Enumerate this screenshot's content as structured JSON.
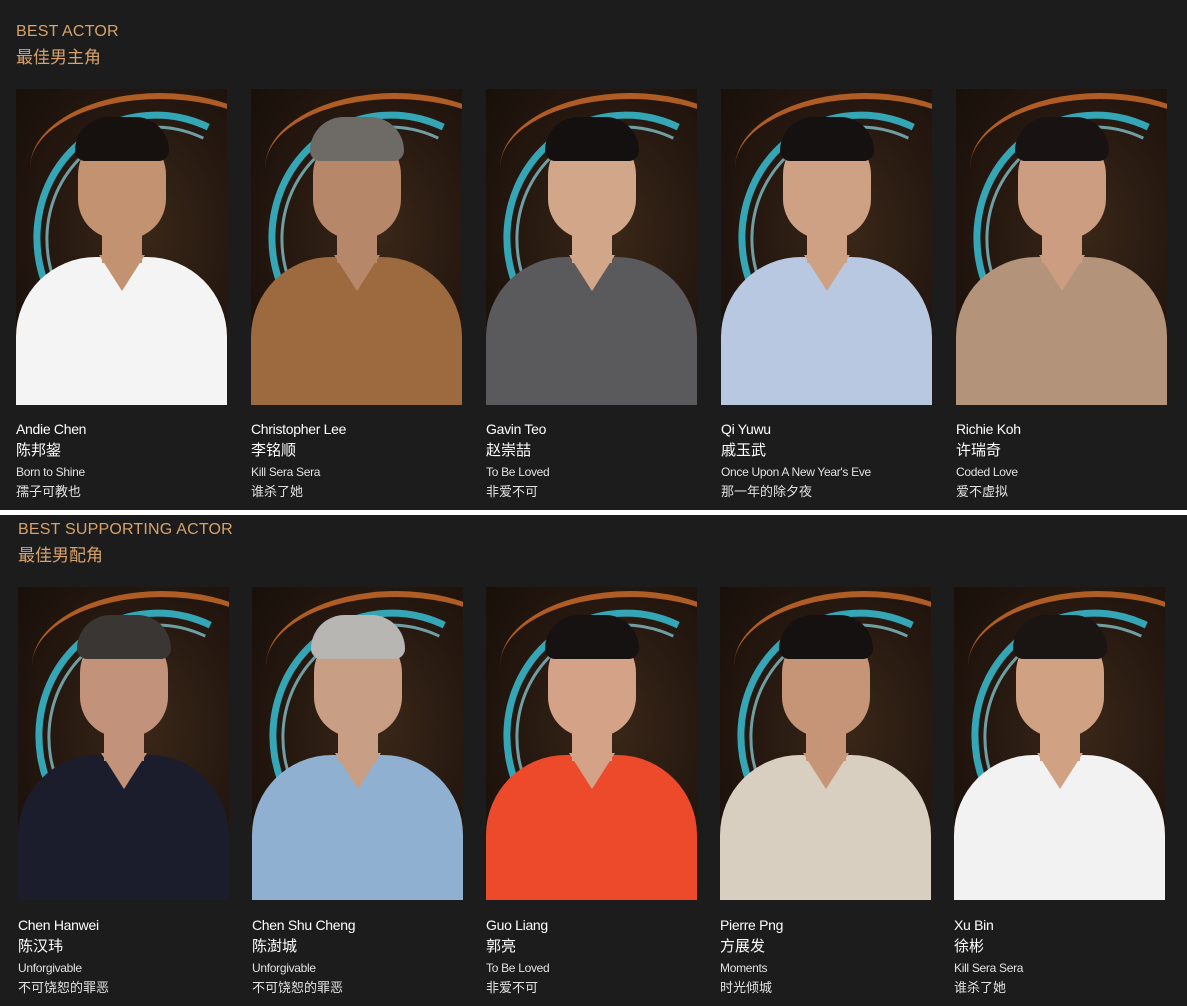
{
  "categories": [
    {
      "title": "BEST ACTOR",
      "subtitle": "最佳男主角",
      "nominees": [
        {
          "name_en": "Andie Chen",
          "name_zh": "陈邦鋆",
          "work_en": "Born to Shine",
          "work_zh": "孺子可教也",
          "outfit": "#f4f4f4",
          "hair": "#16110f",
          "skin": "#c29271"
        },
        {
          "name_en": "Christopher Lee",
          "name_zh": "李铭顺",
          "work_en": "Kill Sera Sera",
          "work_zh": "谁杀了她",
          "outfit": "#9c6a3e",
          "hair": "#6e6a66",
          "skin": "#b7876a"
        },
        {
          "name_en": "Gavin Teo",
          "name_zh": "赵崇喆",
          "work_en": "To Be Loved",
          "work_zh": "非爱不可",
          "outfit": "#5a5a5c",
          "hair": "#141010",
          "skin": "#d2a688"
        },
        {
          "name_en": "Qi Yuwu",
          "name_zh": "戚玉武",
          "work_en": "Once Upon A New Year's Eve",
          "work_zh": "那一年的除夕夜",
          "outfit": "#b8c8e0",
          "hair": "#151111",
          "skin": "#cfa184"
        },
        {
          "name_en": "Richie Koh",
          "name_zh": "许瑞奇",
          "work_en": "Coded Love",
          "work_zh": "爱不虚拟",
          "outfit": "#b3937a",
          "hair": "#181312",
          "skin": "#cc9d80"
        }
      ]
    },
    {
      "title": "BEST SUPPORTING ACTOR",
      "subtitle": "最佳男配角",
      "nominees": [
        {
          "name_en": "Chen Hanwei",
          "name_zh": "陈汉玮",
          "work_en": "Unforgivable",
          "work_zh": "不可饶恕的罪恶",
          "outfit": "#1c1d2c",
          "hair": "#3a3634",
          "skin": "#c2937a"
        },
        {
          "name_en": "Chen Shu Cheng",
          "name_zh": "陈澍城",
          "work_en": "Unforgivable",
          "work_zh": "不可饶恕的罪恶",
          "outfit": "#8fb0d0",
          "hair": "#b8b6b2",
          "skin": "#c89e84"
        },
        {
          "name_en": "Guo Liang",
          "name_zh": "郭亮",
          "work_en": "To Be Loved",
          "work_zh": "非爱不可",
          "outfit": "#ec4a2a",
          "hair": "#161212",
          "skin": "#d4a286"
        },
        {
          "name_en": "Pierre Png",
          "name_zh": "方展发",
          "work_en": "Moments",
          "work_zh": "时光倾城",
          "outfit": "#d8cfc0",
          "hair": "#151111",
          "skin": "#c69578"
        },
        {
          "name_en": "Xu Bin",
          "name_zh": "徐彬",
          "work_en": "Kill Sera Sera",
          "work_zh": "谁杀了她",
          "outfit": "#f2f2f2",
          "hair": "#1a1412",
          "skin": "#d1a184"
        }
      ]
    }
  ]
}
